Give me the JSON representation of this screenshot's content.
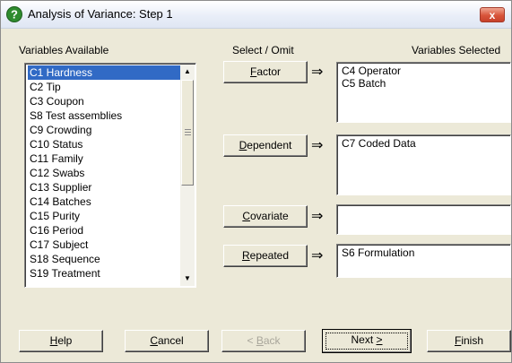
{
  "window": {
    "title": "Analysis of Variance: Step 1",
    "close_label": "x"
  },
  "labels": {
    "variables_available": "Variables Available",
    "select_omit": "Select / Omit",
    "variables_selected": "Variables Selected"
  },
  "variables_available": [
    {
      "label": "C1 Hardness",
      "selected": true
    },
    {
      "label": "C2 Tip"
    },
    {
      "label": "C3 Coupon"
    },
    {
      "label": "S8 Test assemblies"
    },
    {
      "label": "C9 Crowding"
    },
    {
      "label": "C10 Status"
    },
    {
      "label": "C11 Family"
    },
    {
      "label": "C12 Swabs"
    },
    {
      "label": "C13 Supplier"
    },
    {
      "label": "C14 Batches"
    },
    {
      "label": "C15 Purity"
    },
    {
      "label": "C16 Period"
    },
    {
      "label": "C17 Subject"
    },
    {
      "label": "S18 Sequence"
    },
    {
      "label": "S19 Treatment"
    }
  ],
  "scrollbar": {
    "up_glyph": "▲",
    "down_glyph": "▼"
  },
  "roles": {
    "arrow_glyph": "⇒",
    "factor": {
      "label_u": "F",
      "label_rest": "actor",
      "values": [
        "C4 Operator",
        "C5 Batch"
      ]
    },
    "dependent": {
      "label_u": "D",
      "label_rest": "ependent",
      "values": [
        "C7 Coded Data"
      ]
    },
    "covariate": {
      "label_u": "C",
      "label_rest": "ovariate",
      "values": []
    },
    "repeated": {
      "label_u": "R",
      "label_rest": "epeated",
      "values": [
        "S6 Formulation"
      ]
    }
  },
  "buttons": {
    "help_u": "H",
    "help_rest": "elp",
    "cancel_u": "C",
    "cancel_rest": "ancel",
    "back_pre": "< ",
    "back_u": "B",
    "back_rest": "ack",
    "next_pre": "Next ",
    "next_u": ">",
    "finish_u": "F",
    "finish_rest": "inish"
  },
  "colors": {
    "selection": "#316ac5",
    "dialog_face": "#ece9d8",
    "close_button": "#d8543a"
  }
}
